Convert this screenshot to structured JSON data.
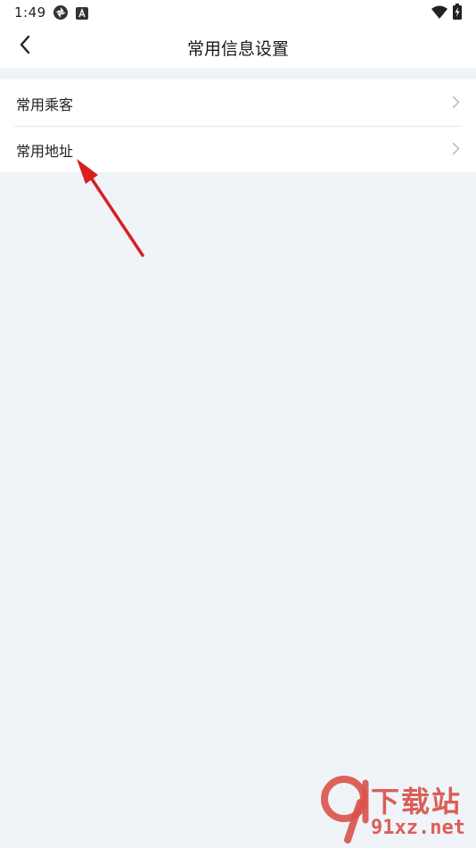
{
  "status_bar": {
    "time": "1:49",
    "icons_left": [
      "aperture-icon",
      "accessibility-a-icon"
    ],
    "icons_right": [
      "wifi-icon",
      "battery-charging-icon"
    ]
  },
  "nav": {
    "back_icon": "chevron-left-icon",
    "title": "常用信息设置"
  },
  "list": {
    "items": [
      {
        "label": "常用乘客",
        "icon": "chevron-right-icon"
      },
      {
        "label": "常用地址",
        "icon": "chevron-right-icon"
      }
    ]
  },
  "annotation": {
    "type": "arrow",
    "color": "#d8201c",
    "points_to": "常用地址"
  },
  "watermark": {
    "brand_cn": "下载站",
    "url": "91xz.net",
    "logo_text": "91",
    "color": "#d9534a"
  },
  "colors": {
    "page_background": "#f0f4f9",
    "surface": "#ffffff",
    "divider": "#e4e6ea",
    "chevron": "#b0b4ba"
  }
}
